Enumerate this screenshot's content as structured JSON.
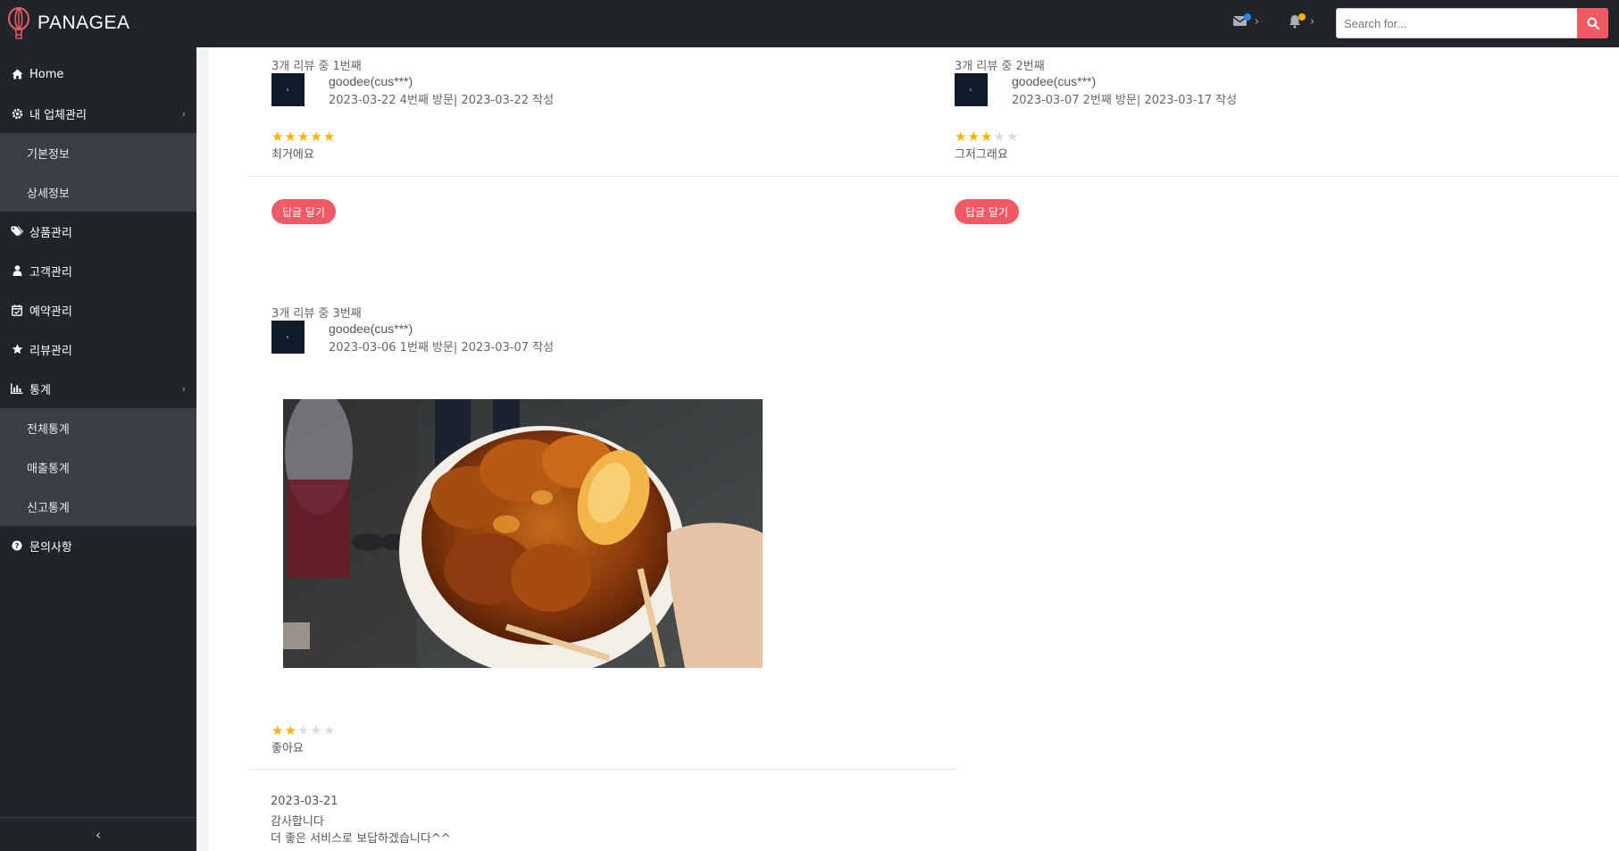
{
  "app": {
    "brand": "PANAGEA"
  },
  "header": {
    "messages_icon": "envelope-icon",
    "messages_dot_color": "#1e88ff",
    "notifications_icon": "bell-icon",
    "notifications_dot_color": "#f5b301",
    "search_placeholder": "Search for...",
    "search_icon": "search-icon"
  },
  "sidebar": {
    "home": "Home",
    "my_business": "내 업체관리",
    "basic_info": "기본정보",
    "detail_info": "상세정보",
    "products": "상품관리",
    "customers": "고객관리",
    "reservations": "예약관리",
    "reviews": "리뷰관리",
    "stats": "통계",
    "stats_all": "전체통계",
    "stats_sales": "매출통계",
    "stats_reports": "신고통계",
    "inquiries": "문의사항",
    "collapse": "‹"
  },
  "reviews": [
    {
      "index": "3개 리뷰 중 1번째",
      "author": "goodee(cus***)",
      "meta": "2023-03-22 4번째 방문| 2023-03-22 작성",
      "rating": 5,
      "text": "최거에요",
      "reply_button": "답글 달기"
    },
    {
      "index": "3개 리뷰 중 2번째",
      "author": "goodee(cus***)",
      "meta": "2023-03-07 2번째 방문| 2023-03-17 작성",
      "rating": 3,
      "text": "그저그래요",
      "reply_button": "답글 달기"
    },
    {
      "index": "3개 리뷰 중 3번째",
      "author": "goodee(cus***)",
      "meta": "2023-03-06 1번째 방문| 2023-03-07 작성",
      "rating": 2,
      "text": "좋아요",
      "reply": {
        "date": "2023-03-21",
        "line1": "감사합니다",
        "line2": "더 좋은 서비스로 보답하겠습니다^^"
      }
    }
  ],
  "colors": {
    "accent": "#f05a66",
    "star": "#f5b301",
    "sidebar": "#212529"
  }
}
